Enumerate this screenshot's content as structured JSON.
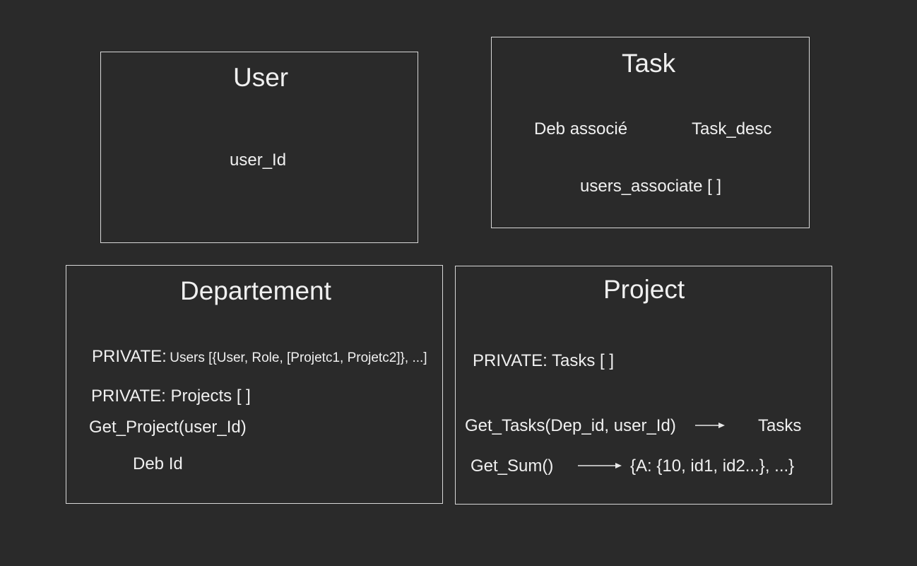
{
  "user": {
    "title": "User",
    "field": "user_Id"
  },
  "task": {
    "title": "Task",
    "field1": "Deb associé",
    "field2": "Task_desc",
    "field3": "users_associate [ ]"
  },
  "departement": {
    "title": "Departement",
    "private_users_prefix": "PRIVATE:",
    "private_users_value": "Users [{User, Role, [Projetc1, Projetc2]}, ...]",
    "private_projects": "PRIVATE: Projects [ ]",
    "method": "Get_Project(user_Id)",
    "field": "Deb Id"
  },
  "project": {
    "title": "Project",
    "private_tasks": "PRIVATE: Tasks [ ]",
    "method1": "Get_Tasks(Dep_id, user_Id)",
    "method1_result": "Tasks",
    "method2": "Get_Sum()",
    "method2_result": "{A: {10, id1, id2...}, ...}"
  }
}
